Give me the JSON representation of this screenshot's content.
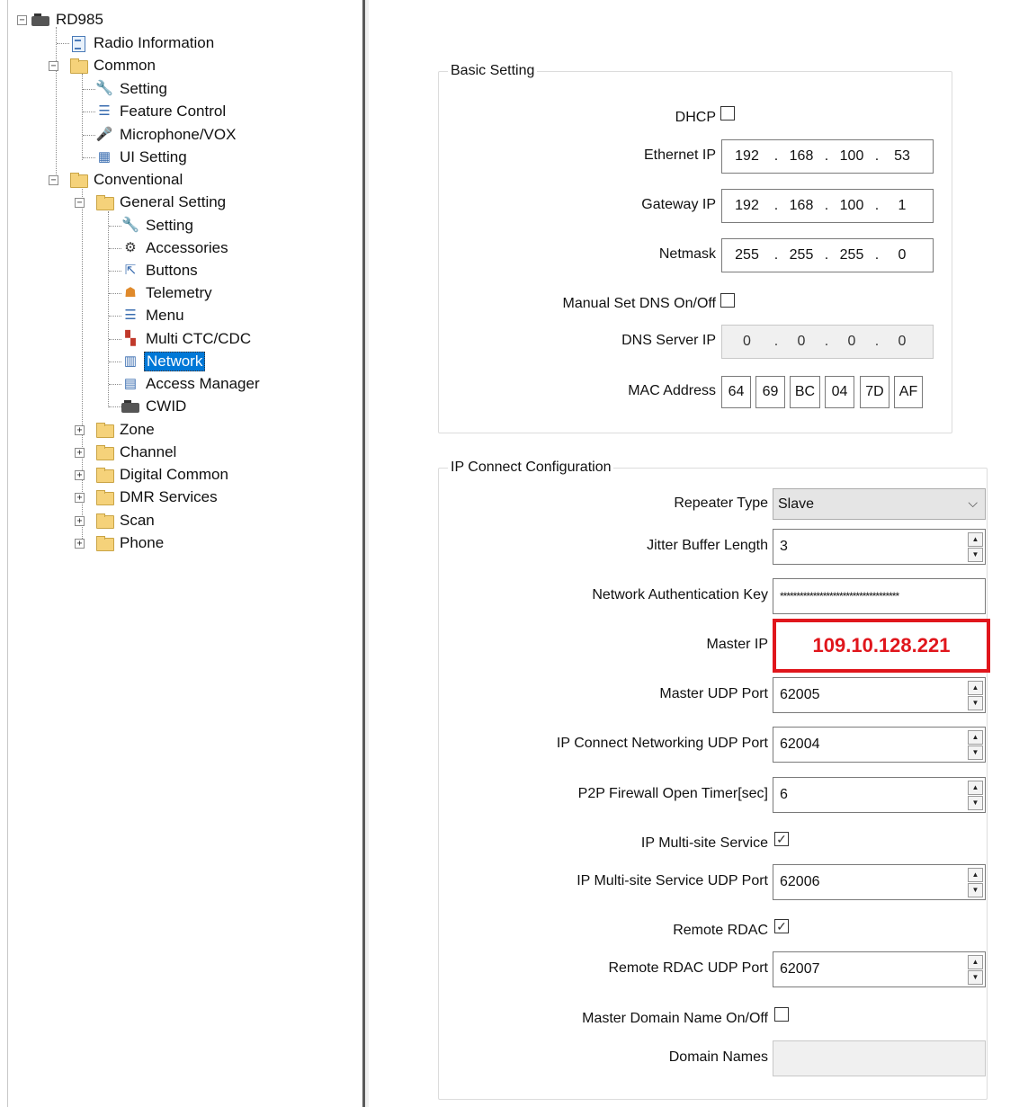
{
  "tree": {
    "root": "RD985",
    "radio_information": "Radio Information",
    "common": "Common",
    "common_setting": "Setting",
    "feature_control": "Feature Control",
    "microphone_vox": "Microphone/VOX",
    "ui_setting": "UI Setting",
    "conventional": "Conventional",
    "general_setting": "General Setting",
    "gs_setting": "Setting",
    "accessories": "Accessories",
    "buttons": "Buttons",
    "telemetry": "Telemetry",
    "menu": "Menu",
    "multi_ctc_cdc": "Multi CTC/CDC",
    "network": "Network",
    "access_manager": "Access Manager",
    "cwid": "CWID",
    "zone": "Zone",
    "channel": "Channel",
    "digital_common": "Digital Common",
    "dmr_services": "DMR Services",
    "scan": "Scan",
    "phone": "Phone"
  },
  "basic": {
    "legend": "Basic Setting",
    "dhcp_label": "DHCP",
    "dhcp_checked": false,
    "ethernet_label": "Ethernet IP",
    "ethernet_ip": [
      "192",
      "168",
      "100",
      "53"
    ],
    "gateway_label": "Gateway IP",
    "gateway_ip": [
      "192",
      "168",
      "100",
      "1"
    ],
    "netmask_label": "Netmask",
    "netmask": [
      "255",
      "255",
      "255",
      "0"
    ],
    "manual_dns_label": "Manual Set DNS On/Off",
    "manual_dns_checked": false,
    "dns_label": "DNS Server IP",
    "dns_ip": [
      "0",
      "0",
      "0",
      "0"
    ],
    "mac_label": "MAC Address",
    "mac": [
      "64",
      "69",
      "BC",
      "04",
      "7D",
      "AF"
    ]
  },
  "ipconnect": {
    "legend": "IP Connect Configuration",
    "repeater_type_label": "Repeater Type",
    "repeater_type_value": "Slave",
    "jitter_label": "Jitter Buffer Length",
    "jitter_value": "3",
    "auth_key_label": "Network Authentication Key",
    "auth_key_value": "************************************",
    "master_ip_label": "Master IP",
    "master_ip_value": "109.10.128.221",
    "master_udp_label": "Master UDP Port",
    "master_udp_value": "62005",
    "ipc_udp_label": "IP Connect Networking UDP Port",
    "ipc_udp_value": "62004",
    "p2p_label": "P2P Firewall Open Timer[sec]",
    "p2p_value": "6",
    "multisite_label": "IP Multi-site Service",
    "multisite_checked": true,
    "multisite_udp_label": "IP Multi-site Service UDP Port",
    "multisite_udp_value": "62006",
    "rdac_label": "Remote RDAC",
    "rdac_checked": true,
    "rdac_udp_label": "Remote RDAC UDP Port",
    "rdac_udp_value": "62007",
    "domain_onoff_label": "Master Domain Name On/Off",
    "domain_onoff_checked": false,
    "domain_names_label": "Domain Names",
    "domain_names_value": ""
  },
  "colors": {
    "highlight": "#e0161c",
    "selection": "#0078d7"
  }
}
